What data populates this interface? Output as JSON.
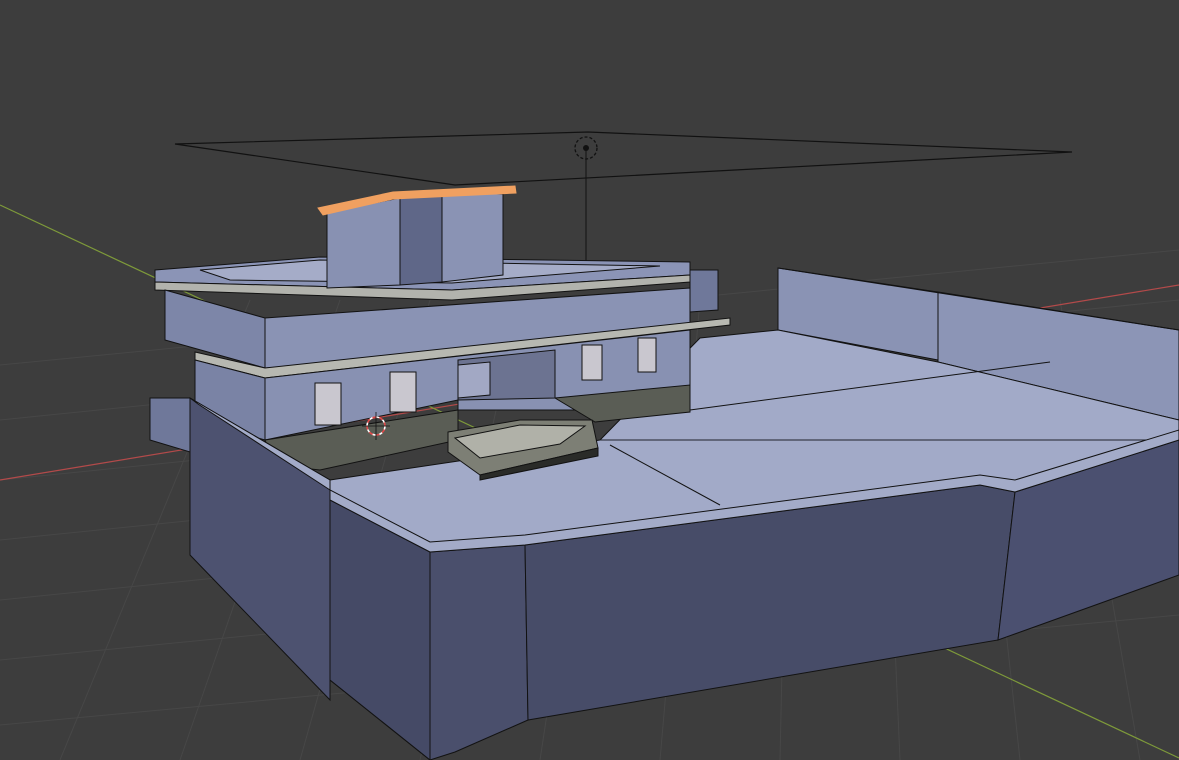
{
  "app": {
    "name": "3D viewport"
  },
  "viewport": {
    "view": "perspective",
    "grid": true,
    "colors": {
      "background": "#3d3d3d",
      "grid_line": "#474747",
      "x_axis": "#b34a4a",
      "y_axis": "#7e9a3a",
      "mesh_face": "#8a93b4",
      "mesh_face_dark": "#4d5270",
      "mesh_wire": "#121212",
      "selected_edge": "#f0a060",
      "cursor": "#e04a4a"
    },
    "objects": [
      {
        "name": "building",
        "icon": "mesh-icon",
        "selected": false
      },
      {
        "name": "roof",
        "icon": "mesh-icon",
        "selected": true
      },
      {
        "name": "courtyard-wall",
        "icon": "mesh-icon",
        "selected": false
      },
      {
        "name": "stairs",
        "icon": "mesh-icon",
        "selected": false
      },
      {
        "name": "area-light",
        "icon": "light-icon",
        "selected": false
      },
      {
        "name": "3d-cursor",
        "icon": "cursor-icon",
        "selected": false
      }
    ]
  }
}
